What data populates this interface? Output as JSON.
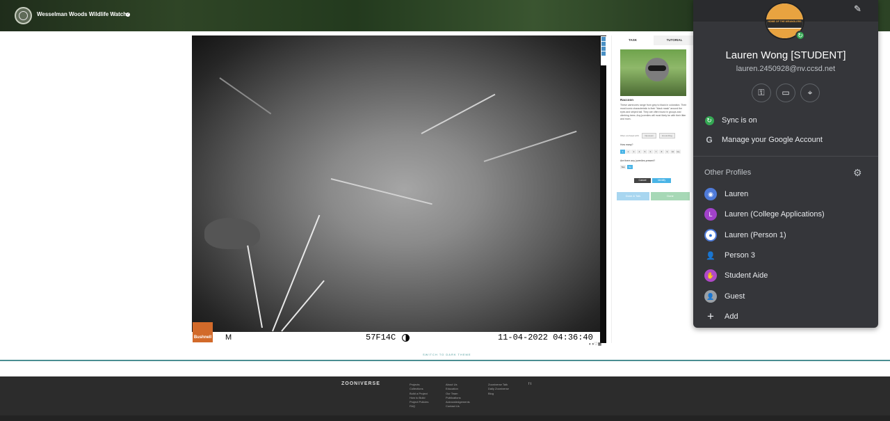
{
  "header": {
    "project_title": "Wesselman Woods Wildlife Watch"
  },
  "camera": {
    "brand": "Bushnell",
    "logo_mark": "M",
    "code": "57F14C",
    "timestamp": "11-04-2022 04:36:40"
  },
  "image_controls": {
    "glyphs": "◐◑♡▦"
  },
  "task": {
    "tabs": [
      "TASK",
      "TUTORIAL"
    ],
    "species_name": "Raccoon",
    "description": "These carnivores range from grey to black in coloration. Their most iconic characteristic is their \"black mask\" around the eyes and striped tail. They are often found in groups and climbing trees. Any juveniles will most likely be with their litter and mom.",
    "confused_with_label": "Often confused with:",
    "confused_with": [
      "Opossum",
      "Groundhog"
    ],
    "q_how_many": "How many?",
    "counts": [
      "1",
      "2",
      "3",
      "4",
      "5",
      "6",
      "7",
      "8",
      "9",
      "10",
      "11+"
    ],
    "selected_count": "1",
    "q_juveniles": "Are there any juveniles present?",
    "yes_no": [
      "Yes",
      "No"
    ],
    "selected_yes_no": "No",
    "cancel": "Cancel",
    "identify": "Identify",
    "done_talk": "Done & Talk",
    "done": "Done"
  },
  "dark_theme_link": "SWITCH TO DARK THEME",
  "footer": {
    "logo": "ZOONIVERSE",
    "col1": [
      "Projects",
      "Collections",
      "Build a Project",
      "How to Build",
      "Project Policies",
      "FAQ"
    ],
    "col2": [
      "About Us",
      "Education",
      "Our Team",
      "Publications",
      "Acknowledgements",
      "Contact Us"
    ],
    "col3": [
      "Zooniverse Talk",
      "Daily Zooniverse",
      "Blog"
    ],
    "social": "f  t"
  },
  "profile_menu": {
    "name": "Lauren Wong [STUDENT]",
    "email": "lauren.2450928@nv.ccsd.net",
    "badge_text": "HOME OF THE WRANGLERS",
    "sync": "Sync is on",
    "manage": "Manage your Google Account",
    "other_profiles_title": "Other Profiles",
    "profiles": [
      {
        "name": "Lauren",
        "color": "#4f7bd9",
        "glyph": "◉"
      },
      {
        "name": "Lauren (College Applications)",
        "color": "#a142c9",
        "glyph": "L"
      },
      {
        "name": "Lauren (Person 1)",
        "color": "#ffffff",
        "glyph": "●"
      },
      {
        "name": "Person 3",
        "color": "#35363a",
        "glyph": "👤"
      },
      {
        "name": "Student Aide",
        "color": "#b049c7",
        "glyph": "✋"
      },
      {
        "name": "Guest",
        "color": "#9aa0a6",
        "glyph": "👤"
      },
      {
        "name": "Add",
        "color": "transparent",
        "glyph": "+"
      }
    ]
  }
}
